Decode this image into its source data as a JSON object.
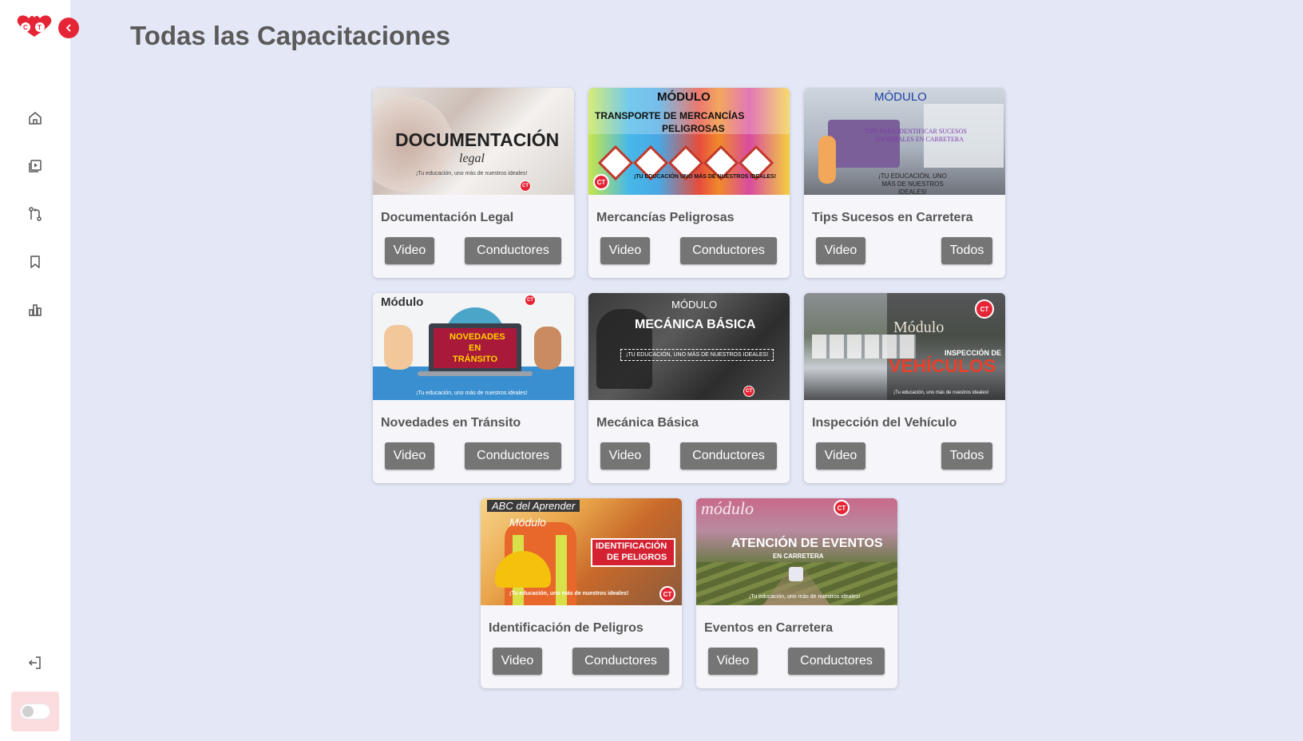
{
  "app": {
    "logo_text": "CT",
    "colors": {
      "accent": "#e52535",
      "background": "#e4e8f6",
      "button": "#757575",
      "title": "#5a5a5a"
    }
  },
  "sidebar": {
    "items": [
      {
        "name": "home",
        "icon": "home-icon"
      },
      {
        "name": "videos",
        "icon": "video-library-icon"
      },
      {
        "name": "routes",
        "icon": "git-compare-icon"
      },
      {
        "name": "saved",
        "icon": "bookmark-icon"
      },
      {
        "name": "stats",
        "icon": "bar-chart-icon"
      }
    ],
    "logout_icon": "logout-icon",
    "theme_toggle": "off"
  },
  "page": {
    "title": "Todas las Capacitaciones"
  },
  "cards": [
    {
      "title": "Documentación Legal",
      "buttons": {
        "video": "Video",
        "audience": "Conductores"
      },
      "thumb": {
        "line1": "DOCUMENTACIÓN",
        "line2": "legal",
        "footer": "¡Tu educación, uno más de nuestros ideales!"
      }
    },
    {
      "title": "Mercancías Peligrosas",
      "buttons": {
        "video": "Video",
        "audience": "Conductores"
      },
      "thumb": {
        "line1": "MÓDULO",
        "line2": "TRANSPORTE DE MERCANCÍAS",
        "line3": "PELIGROSAS",
        "footer": "¡TU EDUCACIÓN UNO MÁS DE NUESTROS IDEALES!"
      }
    },
    {
      "title": "Tips Sucesos en Carretera",
      "buttons": {
        "video": "Video",
        "audience": "Todos"
      },
      "thumb": {
        "line1": "MÓDULO",
        "line2": "TIPS PARA IDENTIFICAR SUCESOS",
        "line3": "ANORMALES EN CARRETERA",
        "footer": "¡TU EDUCACIÓN, UNO MÁS DE NUESTROS IDEALES!"
      }
    },
    {
      "title": "Novedades en Tránsito",
      "buttons": {
        "video": "Video",
        "audience": "Conductores"
      },
      "thumb": {
        "line1": "Módulo",
        "line2": "NOVEDADES",
        "line3": "EN",
        "line4": "TRÁNSITO",
        "footer": "¡Tu educación, uno más de nuestros ideales!"
      }
    },
    {
      "title": "Mecánica Básica",
      "buttons": {
        "video": "Video",
        "audience": "Conductores"
      },
      "thumb": {
        "line1": "MÓDULO",
        "line2": "MECÁNICA BÁSICA",
        "footer": "¡TU EDUCACIÓN, UNO MÁS DE NUESTROS IDEALES!"
      }
    },
    {
      "title": "Inspección del Vehículo",
      "buttons": {
        "video": "Video",
        "audience": "Todos"
      },
      "thumb": {
        "line1": "Módulo",
        "line2": "INSPECCIÓN DE",
        "line3": "VEHÍCULOS",
        "footer": "¡Tu educación, uno más de nuestros ideales!"
      }
    },
    {
      "title": "Identificación de Peligros",
      "buttons": {
        "video": "Video",
        "audience": "Conductores"
      },
      "thumb": {
        "line1": "ABC del Aprender",
        "line2": "Módulo",
        "line3": "IDENTIFICACIÓN",
        "line4": "DE PELIGROS",
        "footer": "¡Tu educación, uno más de nuestros ideales!"
      }
    },
    {
      "title": "Eventos en Carretera",
      "buttons": {
        "video": "Video",
        "audience": "Conductores"
      },
      "thumb": {
        "line1": "módulo",
        "line2": "ATENCIÓN DE EVENTOS",
        "line3": "EN CARRETERA",
        "footer": "¡Tu educación, uno más de nuestros ideales!"
      }
    }
  ]
}
